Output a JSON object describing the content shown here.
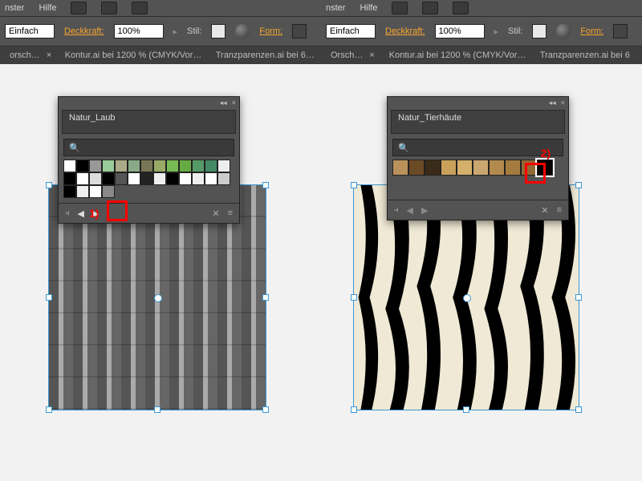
{
  "menu": {
    "item1": "nster",
    "item2": "Hilfe"
  },
  "options": {
    "stroke_label": "Einfach",
    "opacity_label": "Deckkraft:",
    "opacity_value": "100%",
    "style_label": "Stil:",
    "form_label": "Form:"
  },
  "tabs": {
    "t1": "orsch…",
    "t2": "Kontur.ai bei 1200 % (CMYK/Vor…",
    "t3": "Tranzparenzen.ai bei 6…",
    "t1b": "Orsch…",
    "t2b": "Kontur.ai bei 1200 % (CMYK/Vor…",
    "t3b": "Tranzparenzen.ai bei 6"
  },
  "panel_left": {
    "title": "Natur_Laub",
    "search_placeholder": "🔍"
  },
  "panel_right": {
    "title": "Natur_Tierhäute",
    "search_placeholder": "🔍"
  },
  "annotations": {
    "left": "1)",
    "right": "2)"
  },
  "swatch_colors_left_row1": [
    "#fff",
    "#000",
    "#999",
    "#9c9",
    "#aa8",
    "#8a8",
    "#775",
    "#9a6",
    "#7b5",
    "#6a4",
    "#596",
    "#486"
  ],
  "swatch_colors_left_row2": [
    "#eee",
    "#000",
    "#fff",
    "#ddd",
    "#000",
    "#555",
    "#fff",
    "#222",
    "#eee",
    "#000",
    "#fff",
    "#eee"
  ],
  "swatch_colors_left_row3": [
    "#fff",
    "#ccc",
    "#000",
    "#eee",
    "#fff",
    "#888"
  ],
  "swatch_colors_right": [
    "#b9925b",
    "#6b4a26",
    "#3a2c18",
    "#c9a15a",
    "#d4b06b",
    "#caa770",
    "#b38a4d",
    "#a47b3e",
    "#8f6a34",
    "#000"
  ]
}
